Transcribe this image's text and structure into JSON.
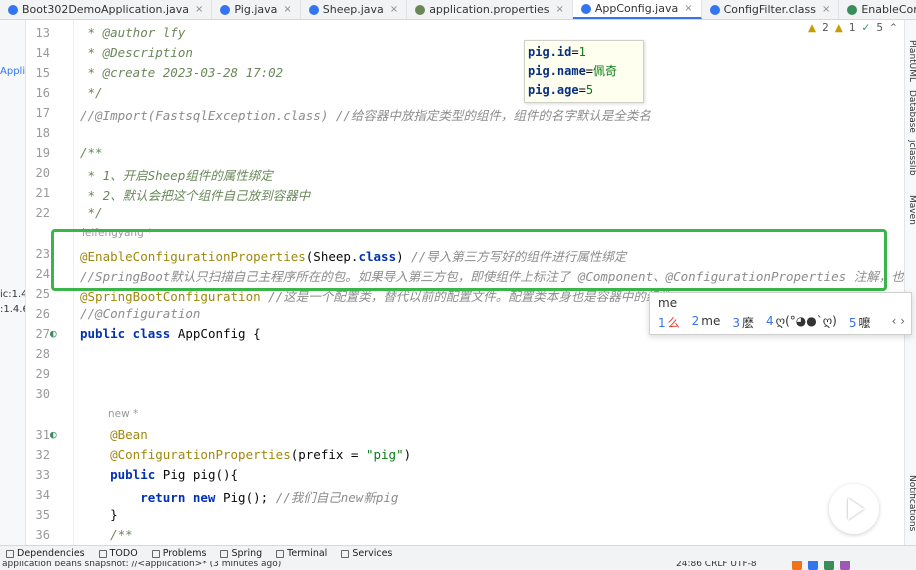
{
  "tabs": [
    {
      "label": "Boot302DemoApplication.java",
      "icon_color": "#3574f0"
    },
    {
      "label": "Pig.java",
      "icon_color": "#3574f0"
    },
    {
      "label": "Sheep.java",
      "icon_color": "#3574f0"
    },
    {
      "label": "application.properties",
      "icon_color": "#6a8759"
    },
    {
      "label": "AppConfig.java",
      "icon_color": "#3574f0",
      "active": true
    },
    {
      "label": "ConfigFilter.class",
      "icon_color": "#3574f0"
    },
    {
      "label": "EnableConfigurationProperties.java",
      "icon_color": "#3a8c5c"
    }
  ],
  "left_labels": [
    "Applic",
    "ic:1.4",
    ":1.4.6"
  ],
  "right_labels": [
    "PlantUML",
    "Database",
    "jclasslib",
    "Maven",
    "Notifications"
  ],
  "inspections": {
    "warnings": "2",
    "weak": "1",
    "typos": "5"
  },
  "lines": [
    {
      "n": "13",
      "text": " * @author lfy"
    },
    {
      "n": "14",
      "text": " * @Description"
    },
    {
      "n": "15",
      "text": " * @create 2023-03-28 17:02"
    },
    {
      "n": "16",
      "text": " */"
    },
    {
      "n": "17",
      "text": "//@Import(FastsqlException.class) //给容器中放指定类型的组件，组件的名字默认是全类名"
    },
    {
      "n": "18",
      "text": ""
    },
    {
      "n": "19",
      "text": "/**"
    },
    {
      "n": "20",
      "text": " * 1、开启Sheep组件的属性绑定"
    },
    {
      "n": "21",
      "text": " * 2、默认会把这个组件自己放到容器中"
    },
    {
      "n": "22",
      "text": " */"
    },
    {
      "n": "23",
      "ann": "@EnableConfigurationProperties",
      "rest": "(Sheep.",
      "kw": "class",
      "tail": ") ",
      "comment": "//导入第三方写好的组件进行属性绑定"
    },
    {
      "n": "24",
      "text": "//SpringBoot默认只扫描自己主程序所在的包。如果导入第三方包，即使组件上标注了 @Component、@ConfigurationProperties 注解，也"
    },
    {
      "n": "25",
      "ann": "@SpringBootConfiguration",
      "comment": " //这是一个配置类，替代以前的配置文件。配置类本身也是容器中的组件"
    },
    {
      "n": "26",
      "text": "//@Configuration"
    },
    {
      "n": "27",
      "kw1": "public class",
      "name": " AppConfig {"
    },
    {
      "n": "28",
      "text": ""
    },
    {
      "n": "29",
      "text": ""
    },
    {
      "n": "30",
      "text": ""
    },
    {
      "n": "31",
      "ann": "    @Bean"
    },
    {
      "n": "32",
      "ann": "    @ConfigurationProperties",
      "rest": "(prefix = ",
      "str": "\"pig\"",
      "tail": ")"
    },
    {
      "n": "33",
      "kw1": "    public",
      "name": " Pig pig(){"
    },
    {
      "n": "34",
      "kw1": "        return new",
      "name": " Pig(); ",
      "comment": "//我们自己new新pig"
    },
    {
      "n": "35",
      "text": "    }"
    },
    {
      "n": "36",
      "text": "    /**"
    }
  ],
  "hints": {
    "author1": "leifengyang *",
    "author2": "new *"
  },
  "props_tooltip": [
    {
      "key": "pig.id",
      "value": "1"
    },
    {
      "key": "pig.name",
      "value": "佩奇"
    },
    {
      "key": "pig.age",
      "value": "5"
    }
  ],
  "ime": {
    "typed": "me",
    "candidates": [
      {
        "num": "1",
        "text": "么"
      },
      {
        "num": "2",
        "text": "me"
      },
      {
        "num": "3",
        "text": "麽"
      },
      {
        "num": "4",
        "text": "ღ(°◕●`ღ)"
      },
      {
        "num": "5",
        "text": "嚒"
      }
    ],
    "arrows": "‹ ›"
  },
  "tool_windows": [
    "Dependencies",
    "TODO",
    "Problems",
    "Spring",
    "Terminal",
    "Services"
  ],
  "status": {
    "message": "application beans snapshot: //<application>* (3 minutes ago)",
    "position": "24:86   CRLF   UTF-8",
    "tray_colors": [
      "#f0731b",
      "#3574f0",
      "#3a8c5c",
      "#9b59b6"
    ]
  }
}
